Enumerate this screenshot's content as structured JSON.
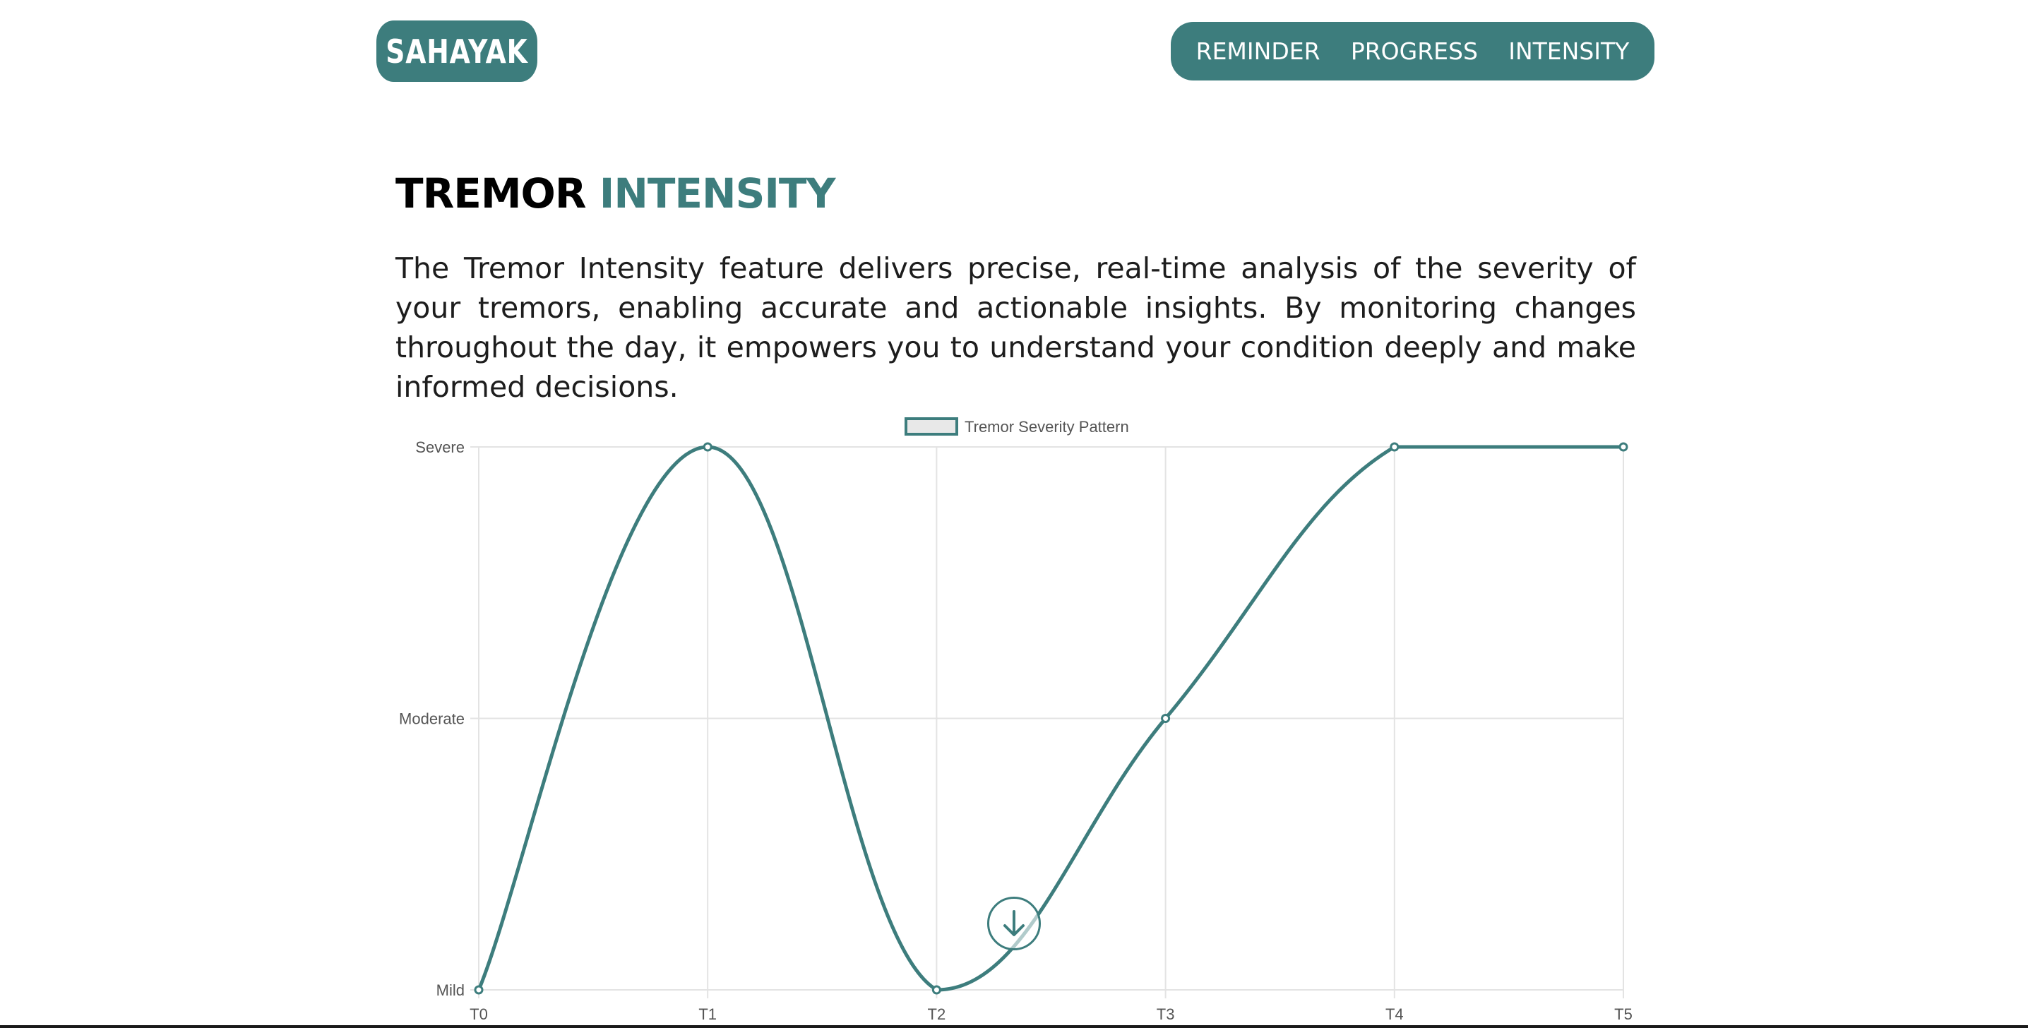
{
  "brand": "SAHAYAK",
  "nav": {
    "items": [
      "REMINDER",
      "PROGRESS",
      "INTENSITY"
    ]
  },
  "section": {
    "title_part1": "TREMOR",
    "title_part2": "INTENSITY",
    "description": "The Tremor Intensity feature delivers precise, real-time analysis of the severity of your tremors, enabling accurate and actionable insights. By monitoring changes throughout the day, it empowers you to understand your condition deeply and make informed decisions."
  },
  "scroll_button_icon": "arrow-down-icon",
  "colors": {
    "accent": "#3d7d7d",
    "legend_fill": "#e8e8e8"
  },
  "chart_data": {
    "type": "line",
    "categories": [
      "T0",
      "T1",
      "T2",
      "T3",
      "T4",
      "T5"
    ],
    "y_levels": [
      "Mild",
      "Moderate",
      "Severe"
    ],
    "series": [
      {
        "name": "Tremor Severity Pattern",
        "values": [
          "Mild",
          "Severe",
          "Mild",
          "Moderate",
          "Severe",
          "Severe"
        ]
      }
    ],
    "legend_position": "top",
    "grid": true,
    "smooth": true
  }
}
